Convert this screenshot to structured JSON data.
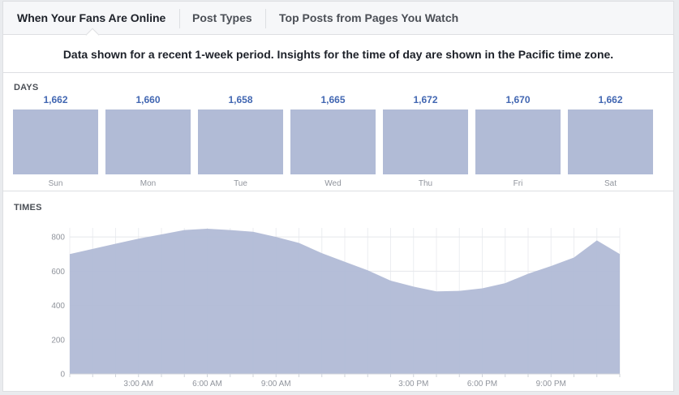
{
  "tabs": [
    {
      "label": "When Your Fans Are Online",
      "active": true
    },
    {
      "label": "Post Types",
      "active": false
    },
    {
      "label": "Top Posts from Pages You Watch",
      "active": false
    }
  ],
  "notice": "Data shown for a recent 1-week period. Insights for the time of day are shown in the Pacific time zone.",
  "days_section": {
    "label": "DAYS",
    "items": [
      {
        "day": "Sun",
        "value": "1,662"
      },
      {
        "day": "Mon",
        "value": "1,660"
      },
      {
        "day": "Tue",
        "value": "1,658"
      },
      {
        "day": "Wed",
        "value": "1,665"
      },
      {
        "day": "Thu",
        "value": "1,672"
      },
      {
        "day": "Fri",
        "value": "1,670"
      },
      {
        "day": "Sat",
        "value": "1,662"
      }
    ]
  },
  "times_section": {
    "label": "TIMES"
  },
  "colors": {
    "bar": "#b1bbd6",
    "value_text": "#4267b2",
    "area": "#b1bbd6"
  },
  "chart_data": [
    {
      "type": "bar",
      "categories": [
        "Sun",
        "Mon",
        "Tue",
        "Wed",
        "Thu",
        "Fri",
        "Sat"
      ],
      "values": [
        1662,
        1660,
        1658,
        1665,
        1672,
        1670,
        1662
      ],
      "title": "DAYS"
    },
    {
      "type": "area",
      "title": "TIMES",
      "x": [
        0,
        1,
        2,
        3,
        4,
        5,
        6,
        7,
        8,
        9,
        10,
        11,
        12,
        13,
        14,
        15,
        16,
        17,
        18,
        19,
        20,
        21,
        22,
        23,
        24
      ],
      "series": [
        {
          "values": [
            700,
            730,
            760,
            790,
            815,
            840,
            848,
            840,
            830,
            800,
            765,
            705,
            655,
            605,
            545,
            510,
            482,
            485,
            500,
            530,
            585,
            630,
            680,
            780,
            700
          ]
        }
      ],
      "x_ticks": [
        {
          "x": 3,
          "label": "3:00 AM"
        },
        {
          "x": 6,
          "label": "6:00 AM"
        },
        {
          "x": 9,
          "label": "9:00 AM"
        },
        {
          "x": 15,
          "label": "3:00 PM"
        },
        {
          "x": 18,
          "label": "6:00 PM"
        },
        {
          "x": 21,
          "label": "9:00 PM"
        }
      ],
      "y_ticks": [
        0,
        200,
        400,
        600,
        800
      ],
      "xlim": [
        0,
        24
      ],
      "ylim": [
        0,
        900
      ],
      "grid": true
    }
  ]
}
